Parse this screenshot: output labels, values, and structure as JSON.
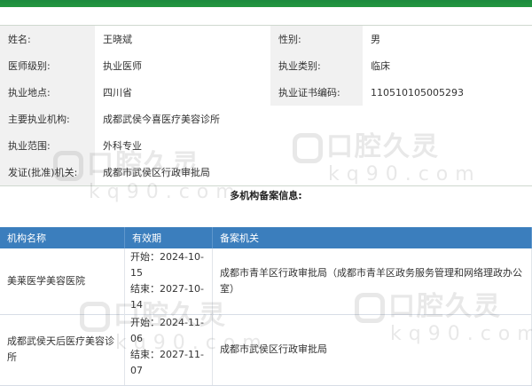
{
  "info": {
    "rows": [
      {
        "label1": "姓名:",
        "value1": "王晓斌",
        "label2": "性别:",
        "value2": "男"
      },
      {
        "label1": "医师级别:",
        "value1": "执业医师",
        "label2": "执业类别:",
        "value2": "临床"
      },
      {
        "label1": "执业地点:",
        "value1": "四川省",
        "label2": "执业证书编码:",
        "value2": "110510105005293"
      }
    ],
    "span_rows": [
      {
        "label": "主要执业机构:",
        "value": "成都武侯今喜医疗美容诊所"
      },
      {
        "label": "执业范围:",
        "value": "外科专业"
      },
      {
        "label": "发证(批准)机关:",
        "value": "成都市武侯区行政审批局"
      }
    ]
  },
  "section_title": "多机构备案信息:",
  "multi_table": {
    "headers": [
      "机构名称",
      "有效期",
      "备案机关"
    ],
    "rows": [
      {
        "name": "美莱医学美容医院",
        "validity": [
          "开始：2024-10-",
          "15",
          "结束：2027-10-",
          "14"
        ],
        "authority": "成都市青羊区行政审批局（成都市青羊区政务服务管理和网络理政办公室）"
      },
      {
        "name": "成都武侯天后医疗美容诊所",
        "validity": [
          "开始：2024-11-",
          "06",
          "结束：2027-11-",
          "07"
        ],
        "authority": "成都市武侯区行政审批局"
      }
    ]
  },
  "watermark": {
    "zh": "口腔久灵",
    "en": "kq90.com"
  },
  "colors": {
    "top_bar": "#1d8a3e",
    "table_header": "#3b7ebd",
    "label_bg": "#f1f1f1"
  }
}
